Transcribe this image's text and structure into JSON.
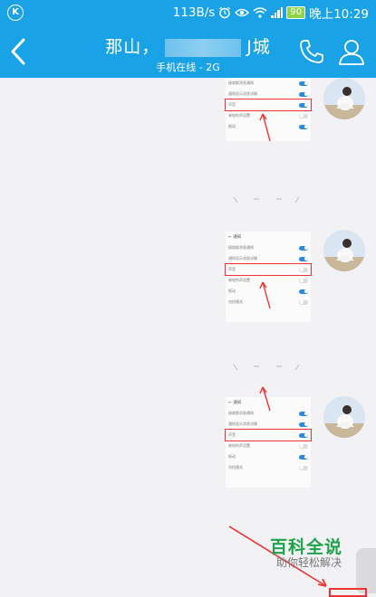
{
  "status_bar": {
    "net_speed": "113B/s",
    "battery": "90",
    "time": "晚上10:29"
  },
  "header": {
    "title_left": "那山，",
    "title_right": "J城",
    "status": "手机在线 - 2G"
  },
  "watermark": {
    "title": "百科全说",
    "subtitle": "助你轻松解决"
  },
  "colors": {
    "header_bg": "#19a3e6",
    "toggle_on": "#2b89e0",
    "highlight": "#e33333",
    "watermark_green": "#1fa34a"
  },
  "icons": [
    "k-icon",
    "alarm-icon",
    "eye-icon",
    "wifi-icon",
    "signal-icon",
    "battery-icon",
    "back-icon",
    "phone-icon",
    "profile-icon"
  ]
}
